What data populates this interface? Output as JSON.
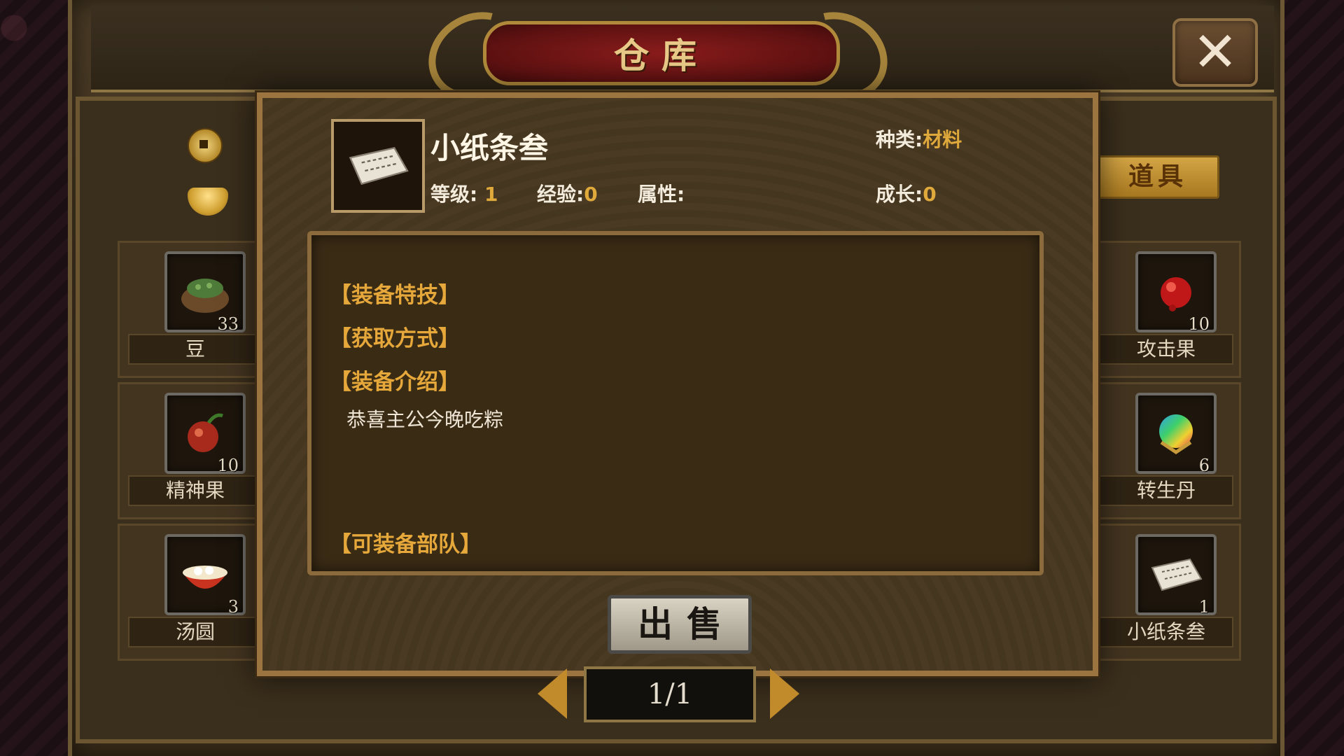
{
  "window": {
    "title": "仓库",
    "close_icon": "close-icon"
  },
  "currencies": [
    {
      "icon": "copper-coin-icon"
    },
    {
      "icon": "gold-ingot-icon"
    }
  ],
  "category_button": "道具",
  "left_items": [
    {
      "label": "豆",
      "count": "33",
      "icon": "bean-sack-icon"
    },
    {
      "label": "精神果",
      "count": "10",
      "icon": "spirit-fruit-icon"
    },
    {
      "label": "汤圆",
      "count": "3",
      "icon": "tangyuan-bowl-icon"
    }
  ],
  "right_items": [
    {
      "label": "攻击果",
      "count": "10",
      "icon": "attack-fruit-icon"
    },
    {
      "label": "转生丹",
      "count": "6",
      "icon": "rebirth-pill-icon"
    },
    {
      "label": "小纸条叁",
      "count": "1",
      "icon": "paper-note-icon"
    }
  ],
  "detail": {
    "name": "小纸条叁",
    "type_label": "种类:",
    "type_value": "材料",
    "level_label": "等级:",
    "level_value": "1",
    "exp_label": "经验:",
    "exp_value": "0",
    "attr_label": "属性:",
    "growth_label": "成长:",
    "growth_value": "0",
    "headings": {
      "skill": "【装备特技】",
      "obtain": "【获取方式】",
      "intro": "【装备介绍】",
      "troops": "【可装备部队】"
    },
    "intro_text": "恭喜主公今晚吃粽",
    "sell_button": "出售"
  },
  "pager": {
    "text": "1/1"
  },
  "colors": {
    "accent_gold": "#e0a93b",
    "title_red": "#8a1c1c",
    "frame_brown": "#3a2e1c"
  }
}
